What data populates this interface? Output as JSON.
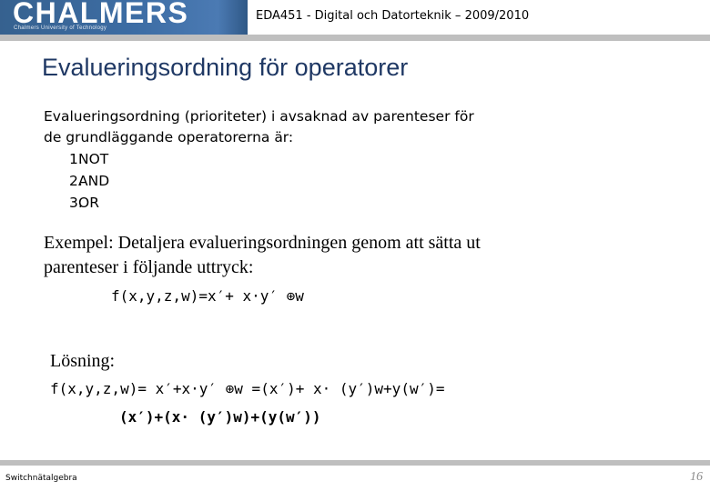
{
  "header": {
    "logo_wordmark": "CHALMERS",
    "logo_tagline": "Chalmers University of Technology",
    "course_title": "EDA451 - Digital och Datorteknik – 2009/2010",
    "logo_background_color": "#3f6da8",
    "rule_color": "#bfbfbf"
  },
  "slide": {
    "title": "Evalueringsordning för operatorer",
    "title_color": "#1f3864"
  },
  "body": {
    "paragraph_line_1": "Evalueringsordning (prioriteter) i avsaknad av parenteser för",
    "paragraph_line_2": "de grundläggande operatorerna är:",
    "list": [
      {
        "number": "1.",
        "label": "NOT"
      },
      {
        "number": "2.",
        "label": "AND"
      },
      {
        "number": "3.",
        "label": "OR"
      }
    ]
  },
  "example": {
    "line_1": "Exempel: Detaljera evalueringsordningen genom att sätta ut",
    "line_2": "parenteser i följande uttryck:",
    "formula": "f(x,y,z,w)=x′+  x·y′ ⊕w"
  },
  "solution": {
    "label": "Lösning:",
    "line_1": "f(x,y,z,w)=  x′+x·y′ ⊕w  =(x′)+  x· (y′)w+y(w′)=",
    "line_2": "(x′)+(x· (y′)w)+(y(w′))"
  },
  "footer": {
    "left_label": "Switchnätalgebra",
    "page_number": "16",
    "page_number_color": "#8c8c8c",
    "rule_color": "#bfbfbf"
  }
}
